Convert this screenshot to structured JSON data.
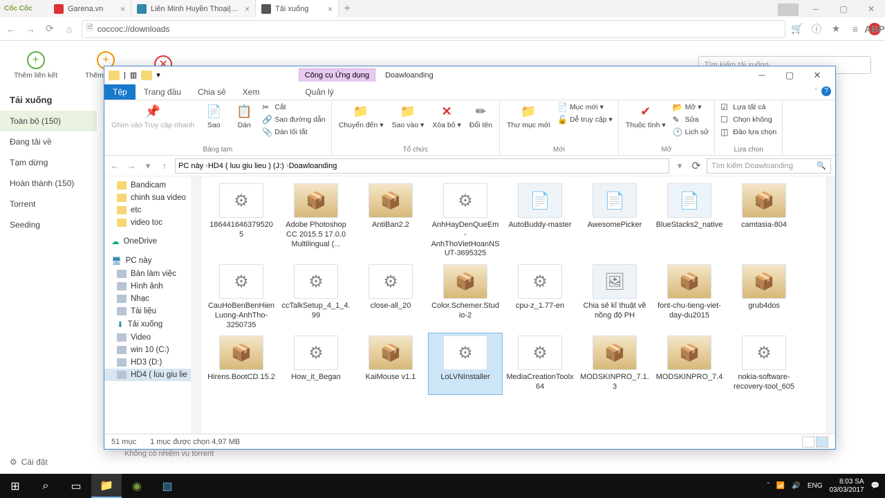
{
  "browser": {
    "logo": "Cốc Cốc",
    "tabs": [
      {
        "label": "Garena.vn",
        "active": false
      },
      {
        "label": "Liên Minh Huyền Thoại|G…",
        "active": false
      },
      {
        "label": "Tải xuống",
        "active": true
      }
    ],
    "url": "coccoc://downloads",
    "toolbar_icons": {
      "cart": "🛒",
      "person": "👤",
      "star": "★",
      "menu": "≡",
      "abp": "ABP"
    }
  },
  "downloads": {
    "actions": {
      "add_link": "Thêm liên kết",
      "add_torrent": "Thêm torrent",
      "cancel_all": "✕"
    },
    "search_placeholder": "Tìm kiếm tải xuống",
    "heading": "Tải xuống",
    "sidebar": [
      "Toàn bộ (150)",
      "Đang tải về",
      "Tạm dừng",
      "Hoàn thành (150)",
      "Torrent",
      "Seeding"
    ],
    "settings": "Cài đặt",
    "torrent_status": "Không có nhiệm vụ torrent"
  },
  "explorer": {
    "context_tab": "Công cụ Ứng dụng",
    "title": "Doawloanding",
    "file_tab": "Tệp",
    "tabs": [
      "Trang đầu",
      "Chia sẻ",
      "Xem",
      "Quản lý"
    ],
    "ribbon": {
      "clipboard": {
        "pin": "Ghim vào Truy cập nhanh",
        "copy": "Sao",
        "paste": "Dán",
        "cut": "Cắt",
        "copy_path": "Sao đường dẫn",
        "shortcut": "Dán lối tắt",
        "label": "Bảng tạm"
      },
      "organize": {
        "move": "Chuyển đến ▾",
        "copy_to": "Sao vào ▾",
        "delete": "Xóa bỏ ▾",
        "rename": "Đổi tên",
        "label": "Tổ chức"
      },
      "new": {
        "folder": "Thư mục mới",
        "new_item": "Mục mới ▾",
        "easy": "Dễ truy cập ▾",
        "label": "Mới"
      },
      "open": {
        "props": "Thuộc tính ▾",
        "open": "Mở ▾",
        "edit": "Sửa",
        "history": "Lịch sử",
        "label": "Mở"
      },
      "select": {
        "all": "Lựa tất cả",
        "none": "Chọn không",
        "invert": "Đảo lựa chọn",
        "label": "Lựa chọn"
      }
    },
    "breadcrumb": [
      "PC này",
      "HD4 ( luu giu lieu ) (J:)",
      "Doawloanding"
    ],
    "search_placeholder": "Tìm kiếm Doawloanding",
    "nav_folders": [
      "Bandicam",
      "chinh sua video",
      "etc",
      "video toc"
    ],
    "nav_onedrive": "OneDrive",
    "nav_pc": "PC này",
    "nav_pc_items": [
      "Bàn làm việc",
      "Hình ảnh",
      "Nhạc",
      "Tài liệu",
      "Tải xuống",
      "Video",
      "win 10 (C:)",
      "HD3 (D:)",
      "HD4 ( luu giu lie"
    ],
    "files": [
      {
        "n": "186441646379520 5",
        "t": "exe"
      },
      {
        "n": "Adobe Photoshop CC 2015.5 17.0.0 Multilingual (...",
        "t": "rar"
      },
      {
        "n": "AntiBan2.2",
        "t": "rar"
      },
      {
        "n": "AnhHayDenQueEm-AnhThoVietHoanNSUT-3695325",
        "t": "exe"
      },
      {
        "n": "AutoBuddy-master",
        "t": "fol"
      },
      {
        "n": "AwesomePicker",
        "t": "fol"
      },
      {
        "n": "BlueStacks2_native",
        "t": "fol"
      },
      {
        "n": "camtasia-804",
        "t": "rar"
      },
      {
        "n": "CauHoBenBenHienLuong-AnhTho-3250735",
        "t": "exe"
      },
      {
        "n": "ccTalkSetup_4_1_4.99",
        "t": "exe"
      },
      {
        "n": "close-all_20",
        "t": "exe"
      },
      {
        "n": "Color.Schemer.Studio-2",
        "t": "rar"
      },
      {
        "n": "cpu-z_1.77-en",
        "t": "exe"
      },
      {
        "n": "Chia sẻ kĩ thuật về nồng độ PH",
        "t": "img"
      },
      {
        "n": "font-chu-tieng-viet-day-du2015",
        "t": "rar"
      },
      {
        "n": "grub4dos",
        "t": "rar"
      },
      {
        "n": "Hirens.BootCD.15.2",
        "t": "rar"
      },
      {
        "n": "How_it_Began",
        "t": "exe"
      },
      {
        "n": "KaiMouse v1.1",
        "t": "rar"
      },
      {
        "n": "LoLVNInstaller",
        "t": "exe",
        "sel": true
      },
      {
        "n": "MediaCreationToolx64",
        "t": "exe"
      },
      {
        "n": "MODSKINPRO_7.1.3",
        "t": "rar"
      },
      {
        "n": "MODSKINPRO_7.4",
        "t": "rar"
      },
      {
        "n": "nokia-software-recovery-tool_605",
        "t": "exe"
      }
    ],
    "status_count": "51 mục",
    "status_sel": "1 mục được chọn  4,97 MB"
  },
  "taskbar": {
    "lang": "ENG",
    "time": "8:03 SA",
    "date": "03/03/2017"
  }
}
